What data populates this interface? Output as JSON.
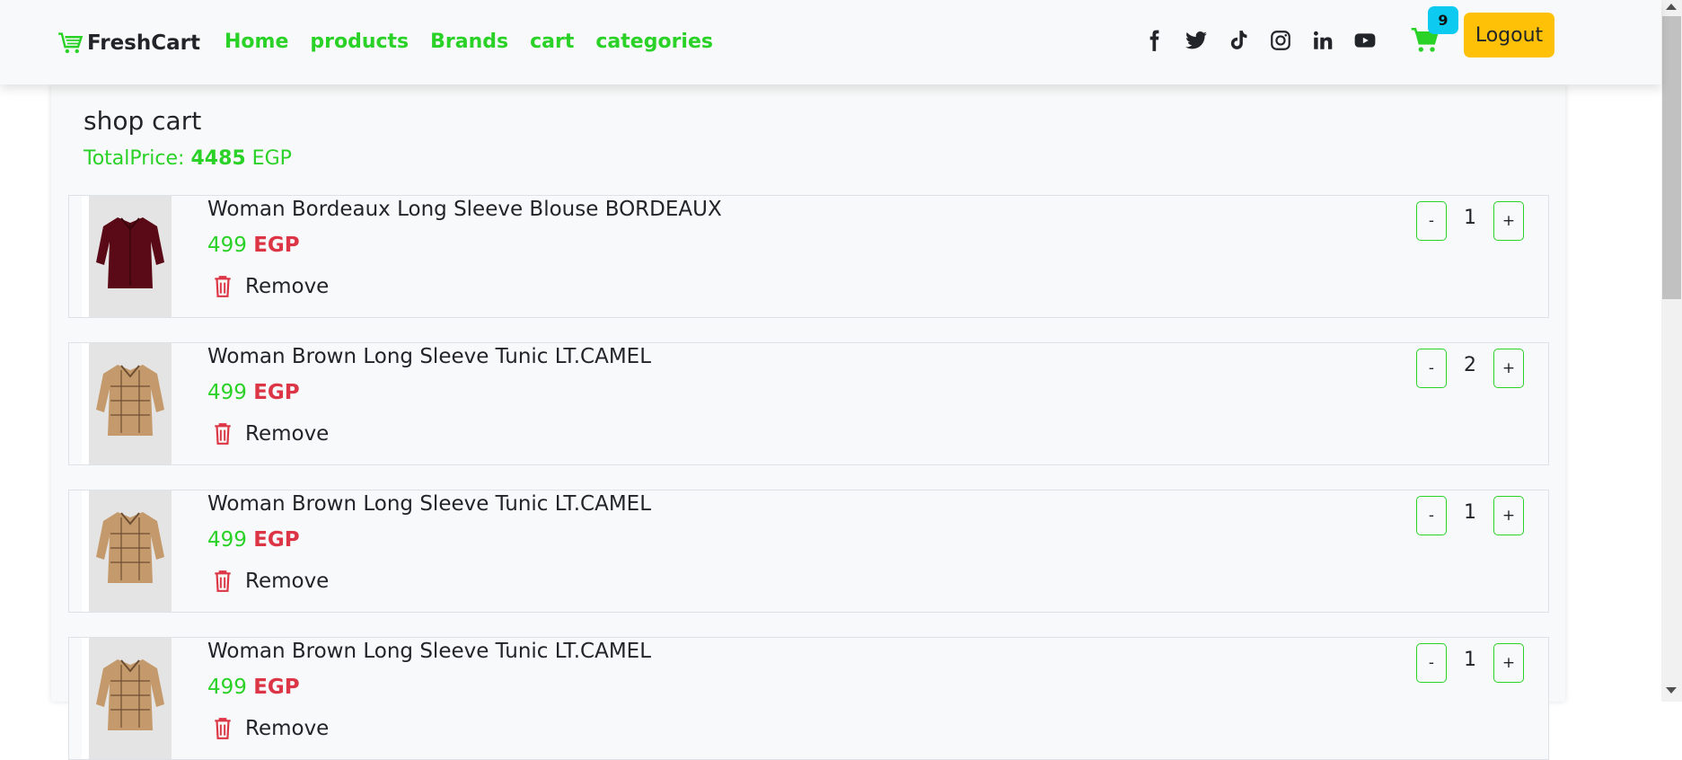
{
  "brand": {
    "name": "FreshCart",
    "icon": "cart-icon"
  },
  "nav": {
    "links": [
      "Home",
      "products",
      "Brands",
      "cart",
      "categories"
    ]
  },
  "social_icons": [
    "facebook-icon",
    "twitter-icon",
    "tiktok-icon",
    "instagram-icon",
    "linkedin-icon",
    "youtube-icon"
  ],
  "cart": {
    "count": "9"
  },
  "logout_label": "Logout",
  "main": {
    "title": "shop cart",
    "total_label": "TotalPrice: ",
    "total_value": "4485",
    "total_currency": " EGP"
  },
  "items": [
    {
      "title": "Woman Bordeaux Long Sleeve Blouse BORDEAUX",
      "price": "499 ",
      "currency": "EGP",
      "remove_label": "Remove",
      "qty": "1",
      "minus": "-",
      "plus": "+",
      "image": "blouse-bordeaux"
    },
    {
      "title": "Woman Brown Long Sleeve Tunic LT.CAMEL",
      "price": "499 ",
      "currency": "EGP",
      "remove_label": "Remove",
      "qty": "2",
      "minus": "-",
      "plus": "+",
      "image": "tunic-camel"
    },
    {
      "title": "Woman Brown Long Sleeve Tunic LT.CAMEL",
      "price": "499 ",
      "currency": "EGP",
      "remove_label": "Remove",
      "qty": "1",
      "minus": "-",
      "plus": "+",
      "image": "tunic-camel"
    },
    {
      "title": "Woman Brown Long Sleeve Tunic LT.CAMEL",
      "price": "499 ",
      "currency": "EGP",
      "remove_label": "Remove",
      "qty": "1",
      "minus": "-",
      "plus": "+",
      "image": "tunic-camel"
    }
  ],
  "colors": {
    "accent": "#2ad127",
    "danger": "#dc3545",
    "badge": "#0dcaf0",
    "logout": "#ffc107"
  }
}
